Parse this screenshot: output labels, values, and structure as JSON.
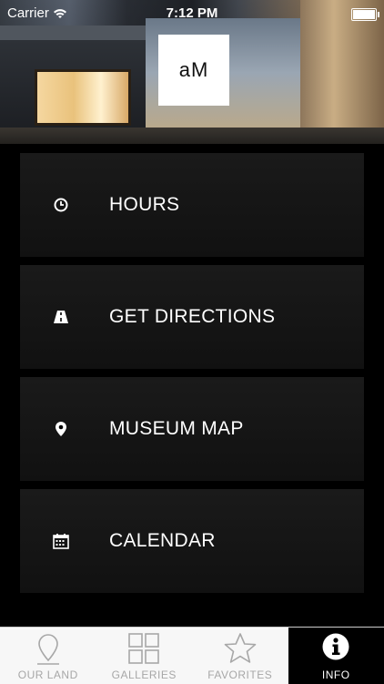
{
  "status": {
    "carrier": "Carrier",
    "time": "7:12 PM"
  },
  "logo": {
    "text": "aM"
  },
  "menu": [
    {
      "label": "HOURS",
      "icon": "clock-icon"
    },
    {
      "label": "GET DIRECTIONS",
      "icon": "road-icon"
    },
    {
      "label": "MUSEUM MAP",
      "icon": "map-pin-icon"
    },
    {
      "label": "CALENDAR",
      "icon": "calendar-icon"
    }
  ],
  "tabs": [
    {
      "label": "OUR LAND",
      "icon": "map-pin-outline-icon",
      "active": false
    },
    {
      "label": "GALLERIES",
      "icon": "grid-icon",
      "active": false
    },
    {
      "label": "FAVORITES",
      "icon": "star-icon",
      "active": false
    },
    {
      "label": "INFO",
      "icon": "info-icon",
      "active": true
    }
  ],
  "colors": {
    "background": "#000000",
    "menu_item": "#151515",
    "tab_inactive": "#a7a7a7",
    "tab_bar": "#f7f7f7"
  }
}
